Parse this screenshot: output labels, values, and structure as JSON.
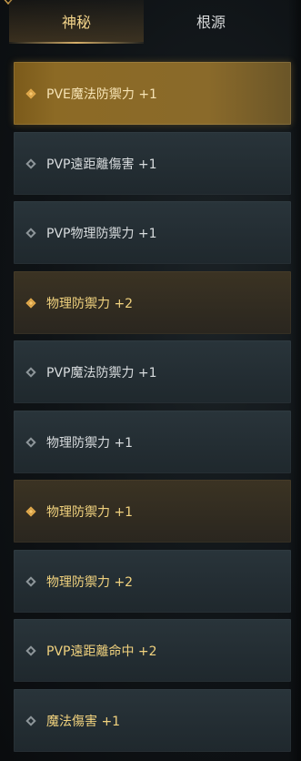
{
  "tabs": [
    {
      "label": "神秘",
      "active": true
    },
    {
      "label": "根源",
      "active": false
    }
  ],
  "items": [
    {
      "label": "PVE魔法防禦力 +1",
      "style": "highlight"
    },
    {
      "label": "PVP遠距離傷害 +1",
      "style": "normal"
    },
    {
      "label": "PVP物理防禦力 +1",
      "style": "normal"
    },
    {
      "label": "物理防禦力 +2",
      "style": "gold"
    },
    {
      "label": "PVP魔法防禦力 +1",
      "style": "normal"
    },
    {
      "label": "物理防禦力 +1",
      "style": "normal"
    },
    {
      "label": "物理防禦力 +1",
      "style": "gold"
    },
    {
      "label": "物理防禦力 +2",
      "style": "normal-goldtext"
    },
    {
      "label": "PVP遠距離命中 +2",
      "style": "normal-goldtext"
    },
    {
      "label": "魔法傷害 +1",
      "style": "normal-goldtext"
    }
  ],
  "colors": {
    "gold_text": "#f1d27e",
    "normal_text": "#d8dcde",
    "accent": "#d7b06a"
  }
}
